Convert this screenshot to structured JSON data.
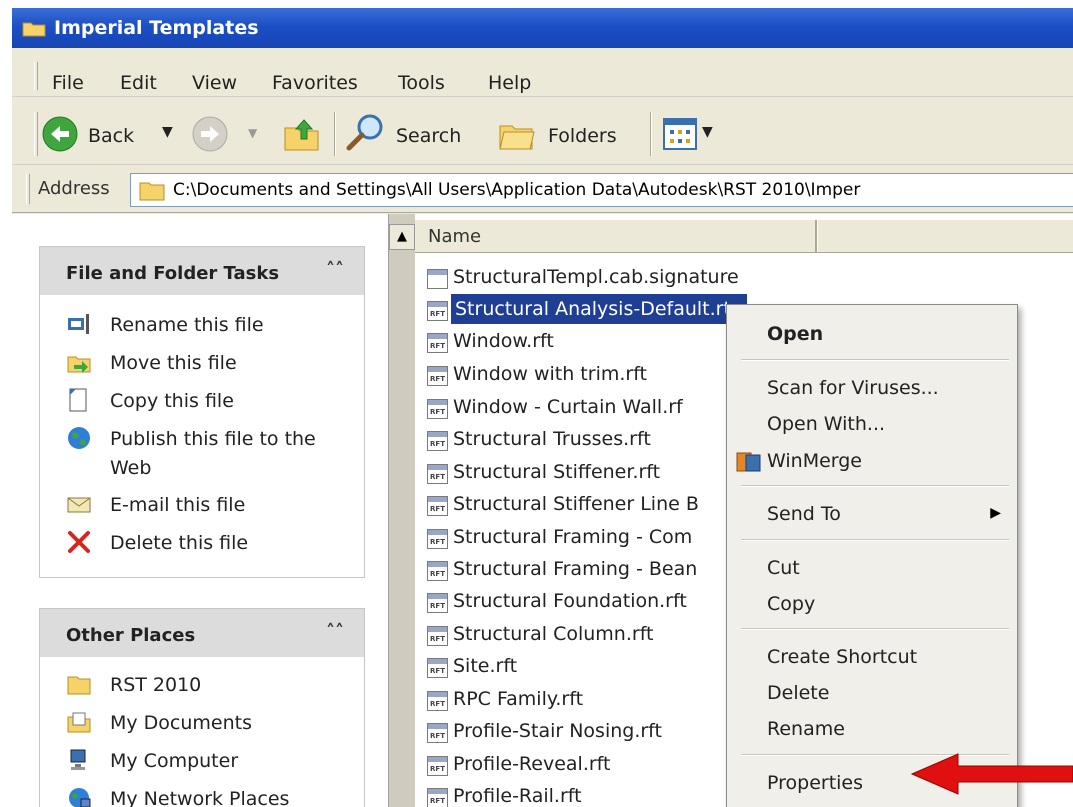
{
  "window": {
    "title": "Imperial Templates"
  },
  "menubar": {
    "items": [
      "File",
      "Edit",
      "View",
      "Favorites",
      "Tools",
      "Help"
    ]
  },
  "toolbar": {
    "back_label": "Back",
    "search_label": "Search",
    "folders_label": "Folders"
  },
  "address": {
    "label": "Address",
    "path": "C:\\Documents and Settings\\All Users\\Application Data\\Autodesk\\RST 2010\\Imper"
  },
  "file_tasks": {
    "header": "File and Folder Tasks",
    "items": [
      {
        "label": "Rename this file",
        "icon": "rename-icon"
      },
      {
        "label": "Move this file",
        "icon": "move-icon"
      },
      {
        "label": "Copy this file",
        "icon": "copy-icon"
      },
      {
        "label": "Publish this file to the Web",
        "icon": "globe-icon"
      },
      {
        "label": "E-mail this file",
        "icon": "email-icon"
      },
      {
        "label": "Delete this file",
        "icon": "delete-x-icon"
      }
    ]
  },
  "other_places": {
    "header": "Other Places",
    "items": [
      {
        "label": "RST 2010",
        "icon": "folder-icon"
      },
      {
        "label": "My Documents",
        "icon": "documents-icon"
      },
      {
        "label": "My Computer",
        "icon": "computer-icon"
      },
      {
        "label": "My Network Places",
        "icon": "network-icon"
      }
    ]
  },
  "filelist": {
    "column_name": "Name",
    "icon_label": "RFT",
    "files": [
      "StructuralTempl.cab.signature",
      "Structural Analysis-Default.rte",
      "Window.rft",
      "Window with trim.rft",
      "Window - Curtain Wall.rf",
      "Structural Trusses.rft",
      "Structural Stiffener.rft",
      "Structural Stiffener Line B",
      "Structural Framing - Com",
      "Structural Framing - Bean",
      "Structural Foundation.rft",
      "Structural Column.rft",
      "Site.rft",
      "RPC Family.rft",
      "Profile-Stair Nosing.rft",
      "Profile-Reveal.rft",
      "Profile-Rail.rft"
    ],
    "selected_index": 1
  },
  "context_menu": {
    "open": "Open",
    "scan": "Scan for Viruses...",
    "open_with": "Open With...",
    "winmerge": "WinMerge",
    "send_to": "Send To",
    "cut": "Cut",
    "copy": "Copy",
    "create_shortcut": "Create Shortcut",
    "delete": "Delete",
    "rename": "Rename",
    "properties": "Properties"
  },
  "colors": {
    "selection": "#1f3f95",
    "arrow": "#e01010",
    "titlebar": "#1b4fc4"
  }
}
